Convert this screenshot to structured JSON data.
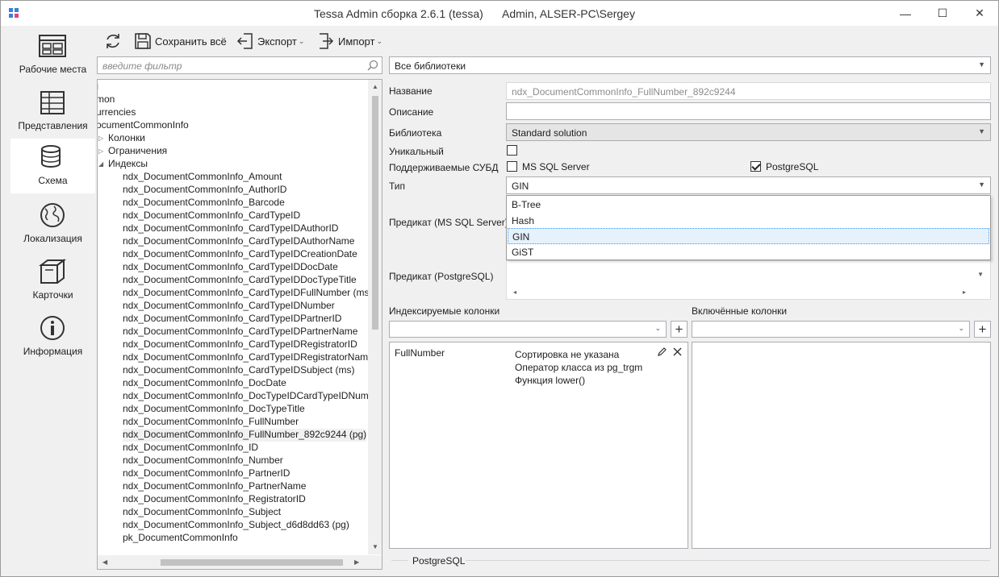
{
  "window": {
    "title": "Tessa Admin сборка 2.6.1 (tessa)",
    "user": "Admin, ALSER-PC\\Sergey",
    "minimize_glyph": "—",
    "maximize_glyph": "☐",
    "close_glyph": "✕"
  },
  "sidebar": {
    "items": [
      {
        "label": "Рабочие места",
        "icon": "workplaces-icon"
      },
      {
        "label": "Представления",
        "icon": "views-icon"
      },
      {
        "label": "Схема",
        "icon": "database-icon"
      },
      {
        "label": "Локализация",
        "icon": "globe-icon"
      },
      {
        "label": "Карточки",
        "icon": "box-icon"
      },
      {
        "label": "Информация",
        "icon": "info-icon"
      }
    ],
    "active": "Схема"
  },
  "toolbar": {
    "refresh_icon": "refresh-icon",
    "save_label": "Сохранить всё",
    "export_label": "Экспорт",
    "import_label": "Импорт",
    "chevron": "⌄"
  },
  "filter": {
    "placeholder": "введите фильтр"
  },
  "tree": {
    "rows": [
      {
        "text": "ı"
      },
      {
        "text": "mon"
      },
      {
        "text": "urrencies"
      },
      {
        "text": "ocumentCommonInfo"
      },
      {
        "text": "Колонки",
        "expander": "▷"
      },
      {
        "text": "Ограничения",
        "expander": "▷"
      },
      {
        "text": "Индексы",
        "expander": "◢"
      },
      {
        "text": "ndx_DocumentCommonInfo_Amount"
      },
      {
        "text": "ndx_DocumentCommonInfo_AuthorID"
      },
      {
        "text": "ndx_DocumentCommonInfo_Barcode"
      },
      {
        "text": "ndx_DocumentCommonInfo_CardTypeID"
      },
      {
        "text": "ndx_DocumentCommonInfo_CardTypeIDAuthorID"
      },
      {
        "text": "ndx_DocumentCommonInfo_CardTypeIDAuthorName"
      },
      {
        "text": "ndx_DocumentCommonInfo_CardTypeIDCreationDate"
      },
      {
        "text": "ndx_DocumentCommonInfo_CardTypeIDDocDate"
      },
      {
        "text": "ndx_DocumentCommonInfo_CardTypeIDDocTypeTitle"
      },
      {
        "text": "ndx_DocumentCommonInfo_CardTypeIDFullNumber (ms)"
      },
      {
        "text": "ndx_DocumentCommonInfo_CardTypeIDNumber"
      },
      {
        "text": "ndx_DocumentCommonInfo_CardTypeIDPartnerID"
      },
      {
        "text": "ndx_DocumentCommonInfo_CardTypeIDPartnerName"
      },
      {
        "text": "ndx_DocumentCommonInfo_CardTypeIDRegistratorID"
      },
      {
        "text": "ndx_DocumentCommonInfo_CardTypeIDRegistratorName"
      },
      {
        "text": "ndx_DocumentCommonInfo_CardTypeIDSubject (ms)"
      },
      {
        "text": "ndx_DocumentCommonInfo_DocDate"
      },
      {
        "text": "ndx_DocumentCommonInfo_DocTypeIDCardTypeIDNumber"
      },
      {
        "text": "ndx_DocumentCommonInfo_DocTypeTitle"
      },
      {
        "text": "ndx_DocumentCommonInfo_FullNumber"
      },
      {
        "text": "ndx_DocumentCommonInfo_FullNumber_892c9244 (pg)",
        "selected": true
      },
      {
        "text": "ndx_DocumentCommonInfo_ID"
      },
      {
        "text": "ndx_DocumentCommonInfo_Number"
      },
      {
        "text": "ndx_DocumentCommonInfo_PartnerID"
      },
      {
        "text": "ndx_DocumentCommonInfo_PartnerName"
      },
      {
        "text": "ndx_DocumentCommonInfo_RegistratorID"
      },
      {
        "text": "ndx_DocumentCommonInfo_Subject"
      },
      {
        "text": "ndx_DocumentCommonInfo_Subject_d6d8dd63 (pg)"
      },
      {
        "text": "pk_DocumentCommonInfo"
      }
    ]
  },
  "library_filter": {
    "value": "Все библиотеки"
  },
  "form": {
    "name_label": "Название",
    "name_value": "ndx_DocumentCommonInfo_FullNumber_892c9244",
    "description_label": "Описание",
    "description_value": "",
    "library_label": "Библиотека",
    "library_value": "Standard solution",
    "unique_label": "Уникальный",
    "dbms_label": "Поддерживаемые СУБД",
    "dbms_mssql_label": "MS SQL Server",
    "dbms_pg_label": "PostgreSQL",
    "type_label": "Тип",
    "type_value": "GIN",
    "type_options": [
      "B-Tree",
      "Hash",
      "GIN",
      "GiST"
    ],
    "predicate_ms_label": "Предикат (MS SQL Server)",
    "predicate_pg_label": "Предикат (PostgreSQL)"
  },
  "columns": {
    "indexed_label": "Индексируемые колонки",
    "included_label": "Включённые колонки",
    "plus": "+",
    "indexed_items": [
      {
        "name": "FullNumber",
        "info": [
          "Сортировка не указана",
          "Оператор класса из pg_trgm",
          "Функция lower()"
        ]
      }
    ]
  },
  "footer_group": {
    "label": "PostgreSQL"
  }
}
